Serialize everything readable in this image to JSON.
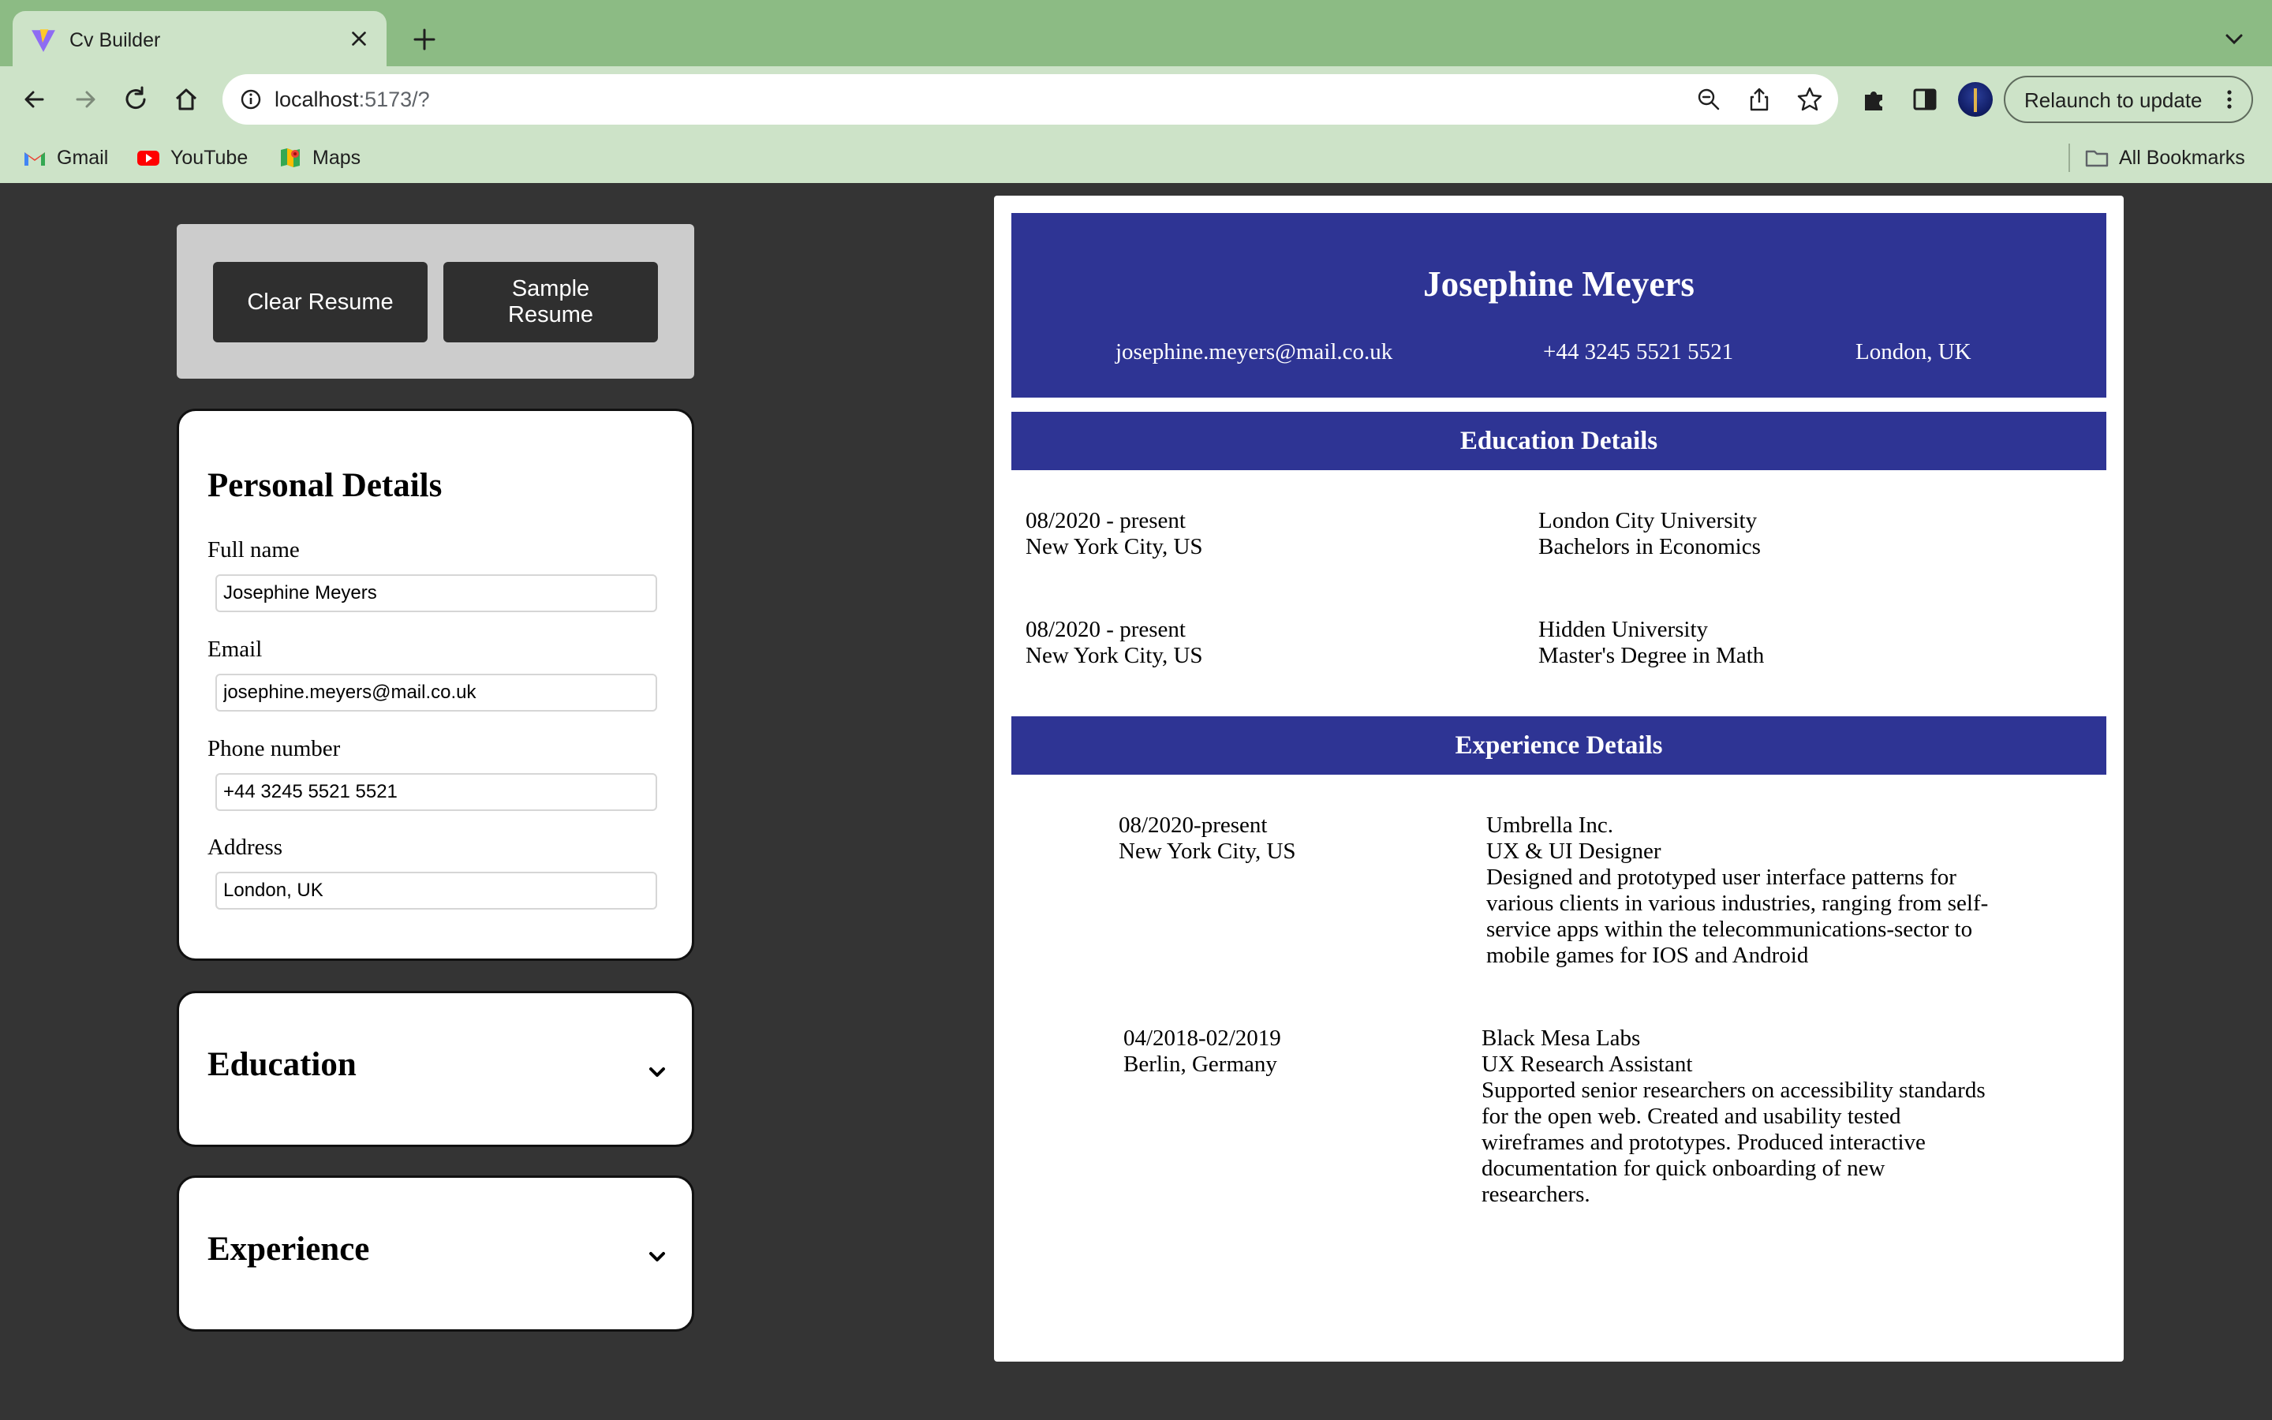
{
  "browser": {
    "tab_title": "Cv Builder",
    "url_host": "localhost",
    "url_rest": ":5173/?",
    "relaunch_label": "Relaunch to update",
    "bookmarks": [
      {
        "label": "Gmail",
        "icon": "gmail-icon"
      },
      {
        "label": "YouTube",
        "icon": "youtube-icon"
      },
      {
        "label": "Maps",
        "icon": "maps-icon"
      }
    ],
    "all_bookmarks_label": "All Bookmarks"
  },
  "controls": {
    "clear_label": "Clear Resume",
    "sample_label": "Sample Resume"
  },
  "personal": {
    "title": "Personal Details",
    "full_name_label": "Full name",
    "full_name_value": "Josephine Meyers",
    "email_label": "Email",
    "email_value": "josephine.meyers@mail.co.uk",
    "phone_label": "Phone number",
    "phone_value": "+44 3245 5521 5521",
    "address_label": "Address",
    "address_value": "London, UK"
  },
  "sections": {
    "education_title": "Education",
    "experience_title": "Experience"
  },
  "resume": {
    "name": "Josephine Meyers",
    "email": "josephine.meyers@mail.co.uk",
    "phone": "+44 3245 5521 5521",
    "address": "London, UK",
    "education_heading": "Education Details",
    "education": [
      {
        "dates": "08/2020 - present",
        "location": "New York City, US",
        "school": "London City University",
        "degree": "Bachelors in Economics"
      },
      {
        "dates": "08/2020 - present",
        "location": "New York City, US",
        "school": "Hidden University",
        "degree": "Master's Degree in Math"
      }
    ],
    "experience_heading": "Experience Details",
    "experience": [
      {
        "dates": "08/2020-present",
        "location": "New York City, US",
        "company": "Umbrella Inc.",
        "position": "UX & UI Designer",
        "description": "Designed and prototyped user interface patterns for\nvarious clients in various industries, ranging from self-\nservice apps within the telecommunications-sector to\nmobile games for IOS and Android"
      },
      {
        "dates": "04/2018-02/2019",
        "location": "Berlin, Germany",
        "company": "Black Mesa Labs",
        "position": "UX Research Assistant",
        "description": "Supported senior researchers on accessibility standards\nfor the open web. Created and usability tested\nwireframes and prototypes. Produced interactive\ndocumentation for quick onboarding of new\nresearchers."
      }
    ]
  },
  "colors": {
    "resume_accent": "#2e3494",
    "page_background": "#343434",
    "button_dark": "#2f2f2f"
  }
}
